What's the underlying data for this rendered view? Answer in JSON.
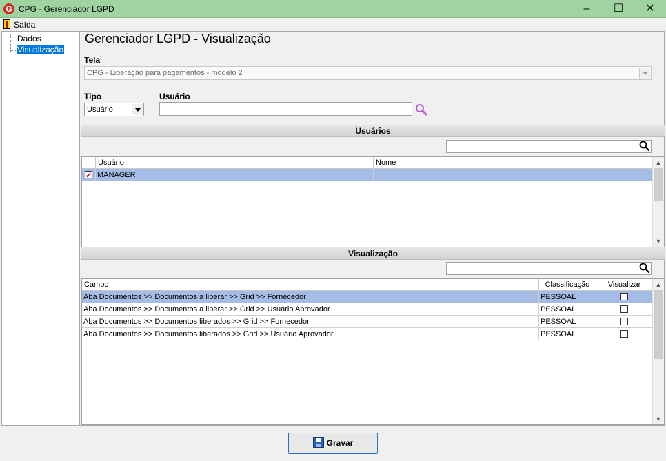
{
  "window": {
    "title": "CPG - Gerenciador LGPD",
    "app_icon_letter": "G",
    "minimize": "–",
    "maximize": "☐",
    "close": "✕"
  },
  "menu": {
    "exit_label": "Saída"
  },
  "tree": {
    "items": [
      "Dados",
      "Visualização"
    ],
    "selected": "Visualização"
  },
  "page": {
    "title": "Gerenciador LGPD - Visualização"
  },
  "form": {
    "tela_label": "Tela",
    "tela_value": "CPG - Liberação para pagamentos - modelo 2",
    "tipo_label": "Tipo",
    "tipo_value": "Usuário",
    "usuario_label": "Usuário",
    "usuario_value": ""
  },
  "users_section": {
    "title": "Usuários",
    "search_value": "",
    "columns": [
      "Usuário",
      "Nome"
    ],
    "rows": [
      {
        "checked": true,
        "usuario": "MANAGER",
        "nome": ""
      }
    ]
  },
  "view_section": {
    "title": "Visualização",
    "search_value": "",
    "columns": [
      "Campo",
      "Classificação",
      "Visualizar"
    ],
    "rows": [
      {
        "campo": "Aba Documentos >> Documentos a liberar >> Grid >> Fornecedor",
        "classificacao": "PESSOAL",
        "visualizar": false
      },
      {
        "campo": "Aba Documentos >> Documentos a liberar >> Grid >> Usuário Aprovador",
        "classificacao": "PESSOAL",
        "visualizar": false
      },
      {
        "campo": "Aba Documentos >> Documentos liberados >> Grid >> Fornecedor",
        "classificacao": "PESSOAL",
        "visualizar": false
      },
      {
        "campo": "Aba Documentos >> Documentos liberados >> Grid >> Usuário Aprovador",
        "classificacao": "PESSOAL",
        "visualizar": false
      }
    ]
  },
  "footer": {
    "save_label": "Gravar"
  },
  "colors": {
    "titlebar": "#9fd3a1",
    "selection": "#a5bde6",
    "tree_selection": "#0078d7",
    "search_icon_purple": "#b05fd0"
  }
}
